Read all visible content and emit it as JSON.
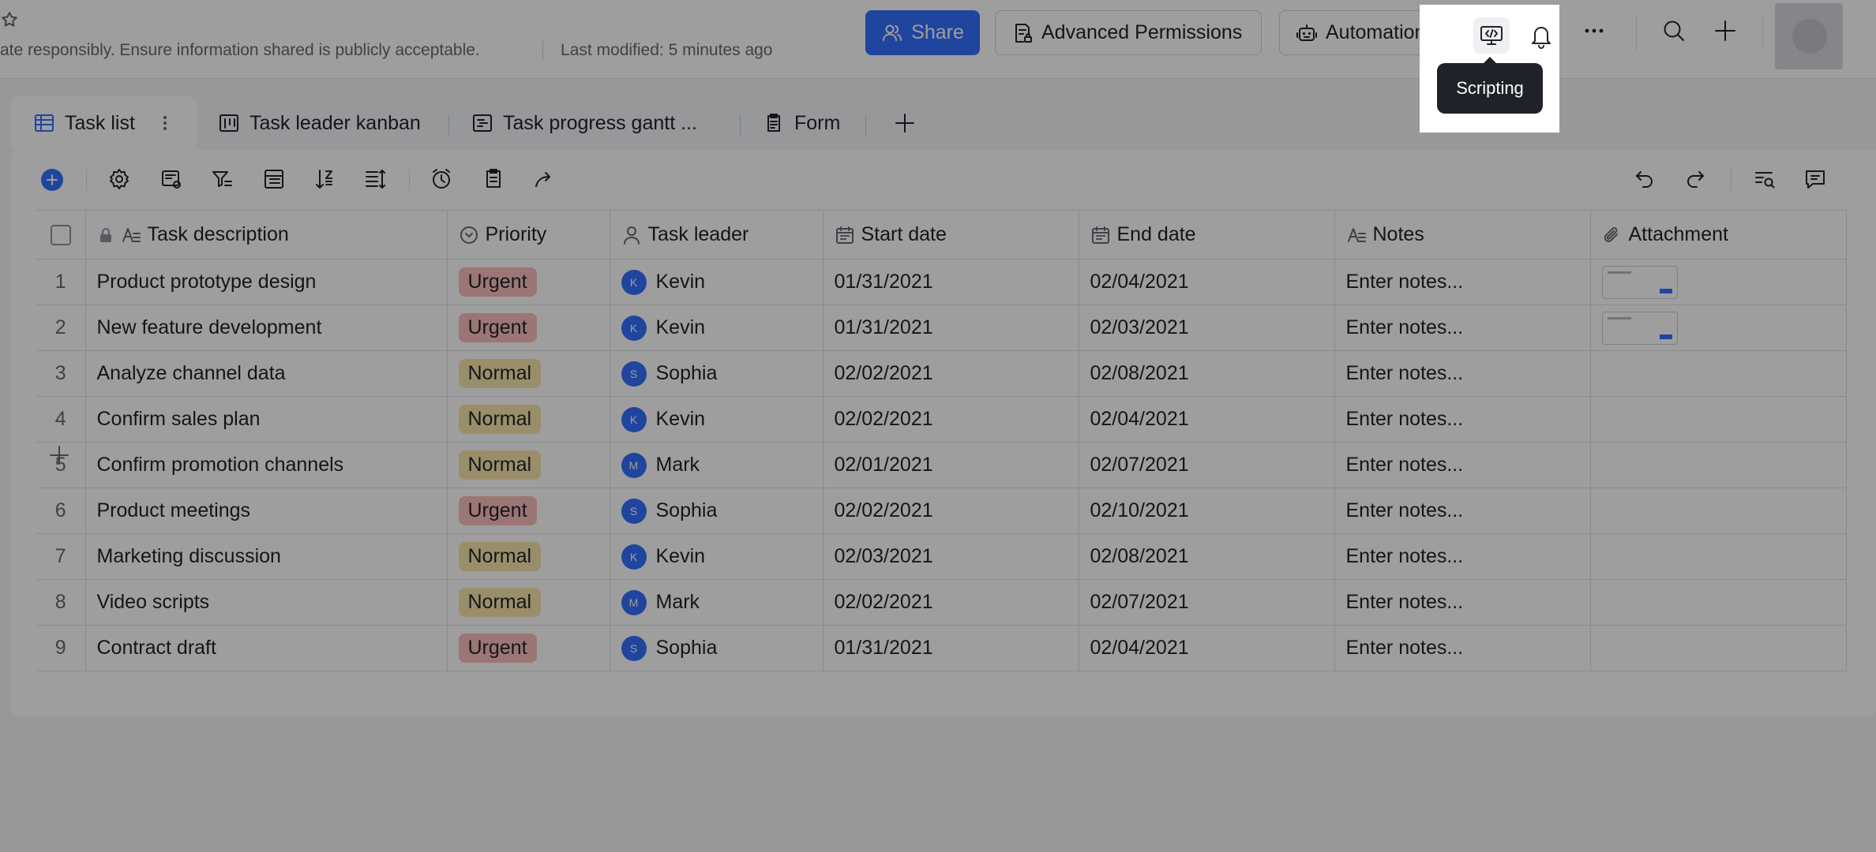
{
  "header": {
    "notice": "ate responsibly. Ensure information shared is publicly acceptable.",
    "last_modified": "Last modified: 5 minutes ago",
    "share_label": "Share",
    "permissions_label": "Advanced Permissions",
    "automations_label": "Automations",
    "scripting_tooltip": "Scripting",
    "accent_color": "#3370ff"
  },
  "tabs": [
    {
      "label": "Task list",
      "icon": "grid-table-icon",
      "active": true
    },
    {
      "label": "Task leader kanban",
      "icon": "kanban-icon"
    },
    {
      "label": "Task progress gantt ...",
      "icon": "gantt-icon"
    },
    {
      "label": "Form",
      "icon": "form-icon"
    }
  ],
  "columns": [
    {
      "label": "Task description",
      "icon": "text-field-icon"
    },
    {
      "label": "Priority",
      "icon": "single-select-icon"
    },
    {
      "label": "Task leader",
      "icon": "person-icon"
    },
    {
      "label": "Start date",
      "icon": "calendar-icon"
    },
    {
      "label": "End date",
      "icon": "calendar-icon"
    },
    {
      "label": "Notes",
      "icon": "text-field-icon"
    },
    {
      "label": "Attachment",
      "icon": "paperclip-icon"
    }
  ],
  "rows": [
    {
      "num": "1",
      "task": "Product prototype design",
      "priority": "Urgent",
      "leader": "Kevin",
      "initial": "K",
      "start": "01/31/2021",
      "end": "02/04/2021",
      "notes": "Enter notes...",
      "attachment": true
    },
    {
      "num": "2",
      "task": "New feature development",
      "priority": "Urgent",
      "leader": "Kevin",
      "initial": "K",
      "start": "01/31/2021",
      "end": "02/03/2021",
      "notes": "Enter notes...",
      "attachment": true
    },
    {
      "num": "3",
      "task": "Analyze channel data",
      "priority": "Normal",
      "leader": "Sophia",
      "initial": "S",
      "start": "02/02/2021",
      "end": "02/08/2021",
      "notes": "Enter notes...",
      "attachment": false
    },
    {
      "num": "4",
      "task": "Confirm sales plan",
      "priority": "Normal",
      "leader": "Kevin",
      "initial": "K",
      "start": "02/02/2021",
      "end": "02/04/2021",
      "notes": "Enter notes...",
      "attachment": false
    },
    {
      "num": "5",
      "task": "Confirm promotion channels",
      "priority": "Normal",
      "leader": "Mark",
      "initial": "M",
      "start": "02/01/2021",
      "end": "02/07/2021",
      "notes": "Enter notes...",
      "attachment": false
    },
    {
      "num": "6",
      "task": "Product meetings",
      "priority": "Urgent",
      "leader": "Sophia",
      "initial": "S",
      "start": "02/02/2021",
      "end": "02/10/2021",
      "notes": "Enter notes...",
      "attachment": false
    },
    {
      "num": "7",
      "task": "Marketing discussion",
      "priority": "Normal",
      "leader": "Kevin",
      "initial": "K",
      "start": "02/03/2021",
      "end": "02/08/2021",
      "notes": "Enter notes...",
      "attachment": false
    },
    {
      "num": "8",
      "task": "Video scripts",
      "priority": "Normal",
      "leader": "Mark",
      "initial": "M",
      "start": "02/02/2021",
      "end": "02/07/2021",
      "notes": "Enter notes...",
      "attachment": false
    },
    {
      "num": "9",
      "task": "Contract draft",
      "priority": "Urgent",
      "leader": "Sophia",
      "initial": "S",
      "start": "01/31/2021",
      "end": "02/04/2021",
      "notes": "Enter notes...",
      "attachment": false
    }
  ]
}
